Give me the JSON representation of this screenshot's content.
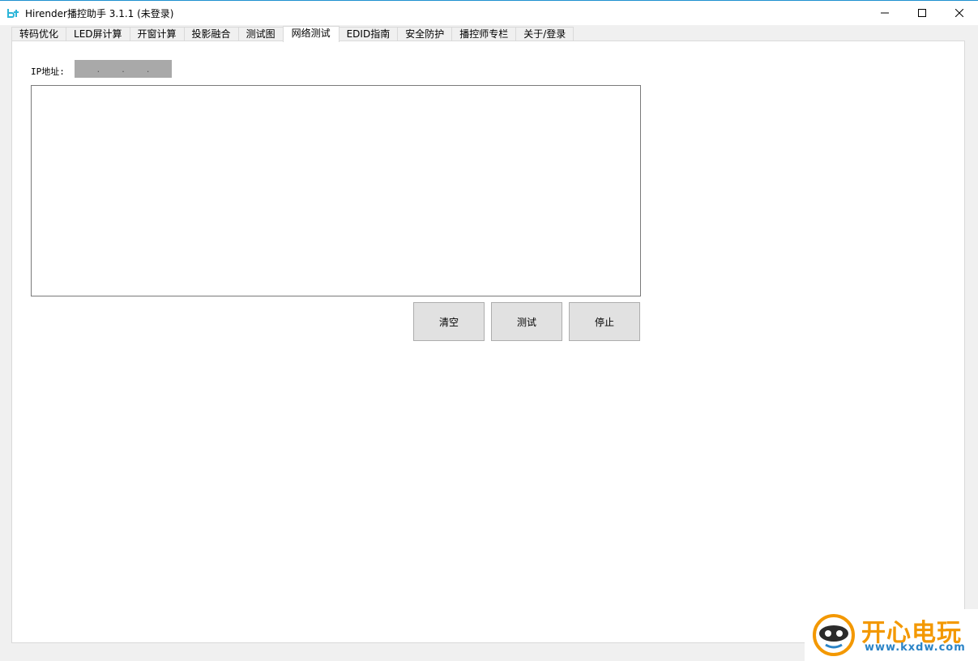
{
  "window": {
    "title": "Hirender播控助手 3.1.1 (未登录)",
    "icons": {
      "app": "hirender-logo-icon",
      "minimize": "minimize-icon",
      "maximize": "maximize-icon",
      "close": "close-icon"
    }
  },
  "tabs": [
    {
      "label": "转码优化",
      "active": false
    },
    {
      "label": "LED屏计算",
      "active": false
    },
    {
      "label": "开窗计算",
      "active": false
    },
    {
      "label": "投影融合",
      "active": false
    },
    {
      "label": "测试图",
      "active": false
    },
    {
      "label": "网络测试",
      "active": true
    },
    {
      "label": "EDID指南",
      "active": false
    },
    {
      "label": "安全防护",
      "active": false
    },
    {
      "label": "播控师专栏",
      "active": false
    },
    {
      "label": "关于/登录",
      "active": false
    }
  ],
  "network_test": {
    "ip_label": "IP地址:",
    "ip_dots": [
      ".",
      ".",
      "."
    ],
    "output_text": "",
    "buttons": {
      "clear": "清空",
      "test": "测试",
      "stop": "停止"
    }
  },
  "watermark": {
    "brand": "开心电玩",
    "url": "www.kxdw.com"
  },
  "colors": {
    "accent": "#1e90d0",
    "watermark_orange": "#f39800",
    "watermark_blue": "#2a83c6"
  }
}
